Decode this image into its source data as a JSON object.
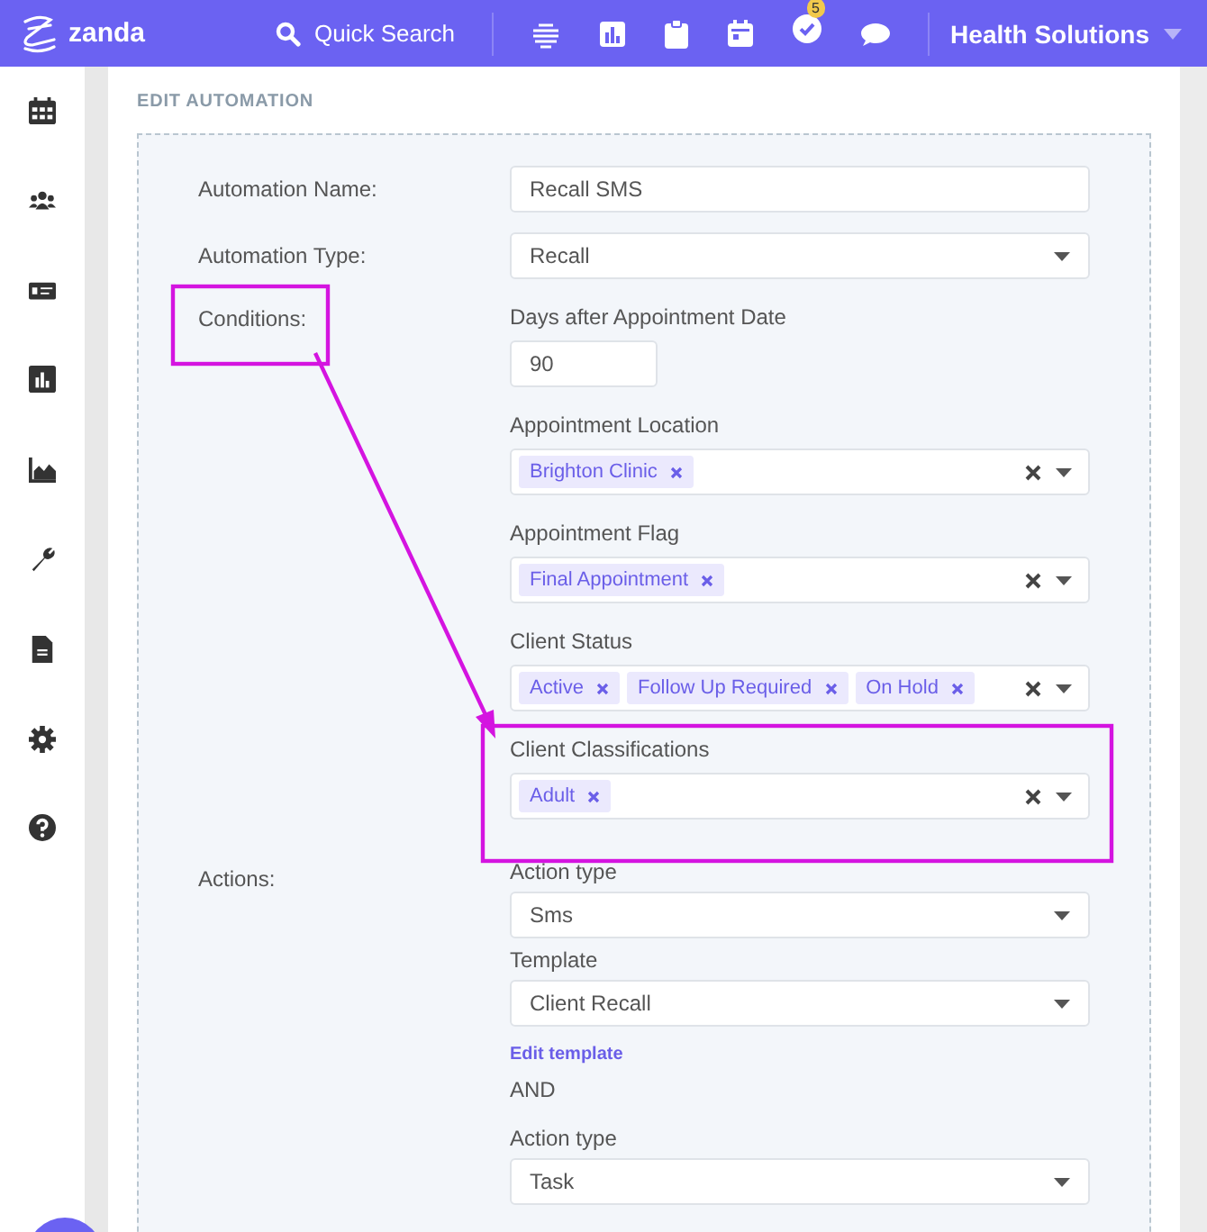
{
  "topbar": {
    "brand": "zanda",
    "search_label": "Quick Search",
    "tasks_badge": "5",
    "account": "Health Solutions"
  },
  "page_title": "EDIT AUTOMATION",
  "rows": [
    {
      "label": "Automation Name:",
      "fields": [
        {
          "kind": "text",
          "value": "Recall SMS"
        }
      ]
    },
    {
      "label": "Automation Type:",
      "fields": [
        {
          "kind": "select",
          "value": "Recall"
        }
      ]
    },
    {
      "label": "Conditions:",
      "fields": [
        {
          "kind": "short",
          "caption": "Days after Appointment Date",
          "value": "90"
        },
        {
          "kind": "multi",
          "caption": "Appointment Location",
          "tags": [
            "Brighton Clinic"
          ]
        },
        {
          "kind": "multi",
          "caption": "Appointment Flag",
          "tags": [
            "Final Appointment"
          ]
        },
        {
          "kind": "multi",
          "caption": "Client Status",
          "tags": [
            "Active",
            "Follow Up Required",
            "On Hold"
          ]
        },
        {
          "kind": "multi",
          "caption": "Client Classifications",
          "tags": [
            "Adult"
          ]
        }
      ]
    },
    {
      "label": "Actions:",
      "fields": [
        {
          "kind": "select",
          "caption": "Action type",
          "value": "Sms"
        },
        {
          "kind": "select",
          "caption": "Template",
          "value": "Client Recall"
        },
        {
          "kind": "link",
          "text": "Edit template"
        },
        {
          "kind": "note",
          "text": "AND"
        },
        {
          "kind": "select",
          "caption": "Action type",
          "value": "Task"
        }
      ]
    }
  ]
}
